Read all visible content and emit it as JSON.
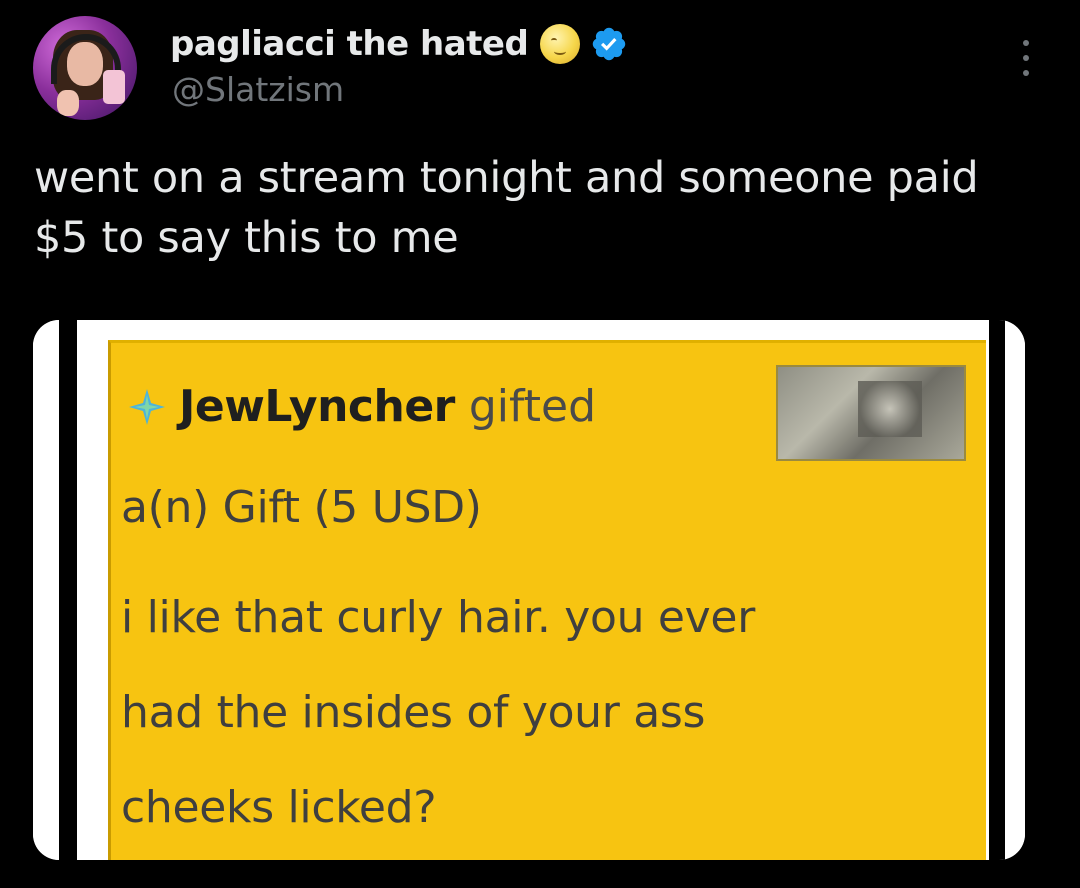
{
  "tweet": {
    "author": {
      "display_name": "pagliacci the hated",
      "name_emoji": "moon-face-icon",
      "verified_icon": "verified-badge-icon",
      "handle": "@Slatzism"
    },
    "more_icon": "more-options-icon",
    "text_lines": [
      "went on a stream tonight and someone paid",
      "$5 to say this to me"
    ]
  },
  "media": {
    "gift_card": {
      "icon": "gift-sparkle-icon",
      "username": "JewLyncher",
      "verb": "gifted",
      "amount_line": "a(n) Gift (5 USD)",
      "message_lines": [
        "i like that curly hair. you ever",
        "had the insides of your ass",
        "cheeks licked?"
      ],
      "background_color": "#f7c411"
    }
  },
  "colors": {
    "background": "#000000",
    "text_primary": "#e7e9ea",
    "text_secondary": "#71767b",
    "verified_blue": "#1d9bf0"
  }
}
